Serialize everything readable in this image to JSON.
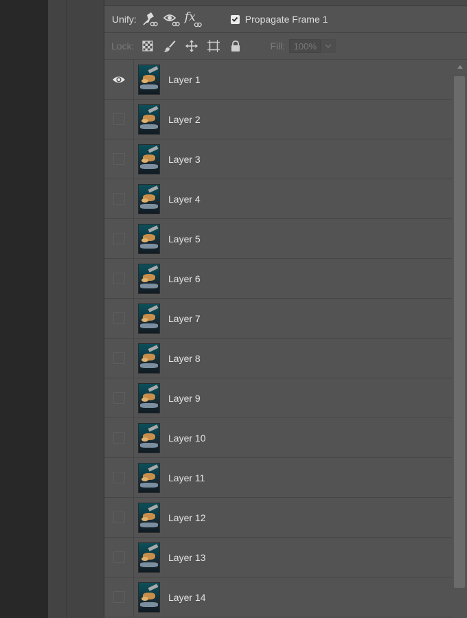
{
  "unify": {
    "label": "Unify:",
    "icons": [
      "unify-position-icon",
      "unify-visibility-icon",
      "unify-style-icon"
    ],
    "fx_text": "fx",
    "propagate_checked": true,
    "propagate_label": "Propagate Frame 1"
  },
  "lock": {
    "label": "Lock:",
    "icons": [
      "lock-transparent-pixels-icon",
      "lock-image-pixels-icon",
      "lock-position-icon",
      "lock-artboard-icon",
      "lock-all-icon"
    ],
    "fill_label": "Fill:",
    "fill_value": "100%"
  },
  "layers": [
    {
      "name": "Layer 1",
      "visible": true
    },
    {
      "name": "Layer 2",
      "visible": false
    },
    {
      "name": "Layer 3",
      "visible": false
    },
    {
      "name": "Layer 4",
      "visible": false
    },
    {
      "name": "Layer 5",
      "visible": false
    },
    {
      "name": "Layer 6",
      "visible": false
    },
    {
      "name": "Layer 7",
      "visible": false
    },
    {
      "name": "Layer 8",
      "visible": false
    },
    {
      "name": "Layer 9",
      "visible": false
    },
    {
      "name": "Layer 10",
      "visible": false
    },
    {
      "name": "Layer 11",
      "visible": false
    },
    {
      "name": "Layer 12",
      "visible": false
    },
    {
      "name": "Layer 13",
      "visible": false
    },
    {
      "name": "Layer 14",
      "visible": false
    }
  ],
  "colors": {
    "panel_bg": "#535353",
    "text": "#e6e6e6",
    "disabled_text": "#7a7a7a"
  }
}
